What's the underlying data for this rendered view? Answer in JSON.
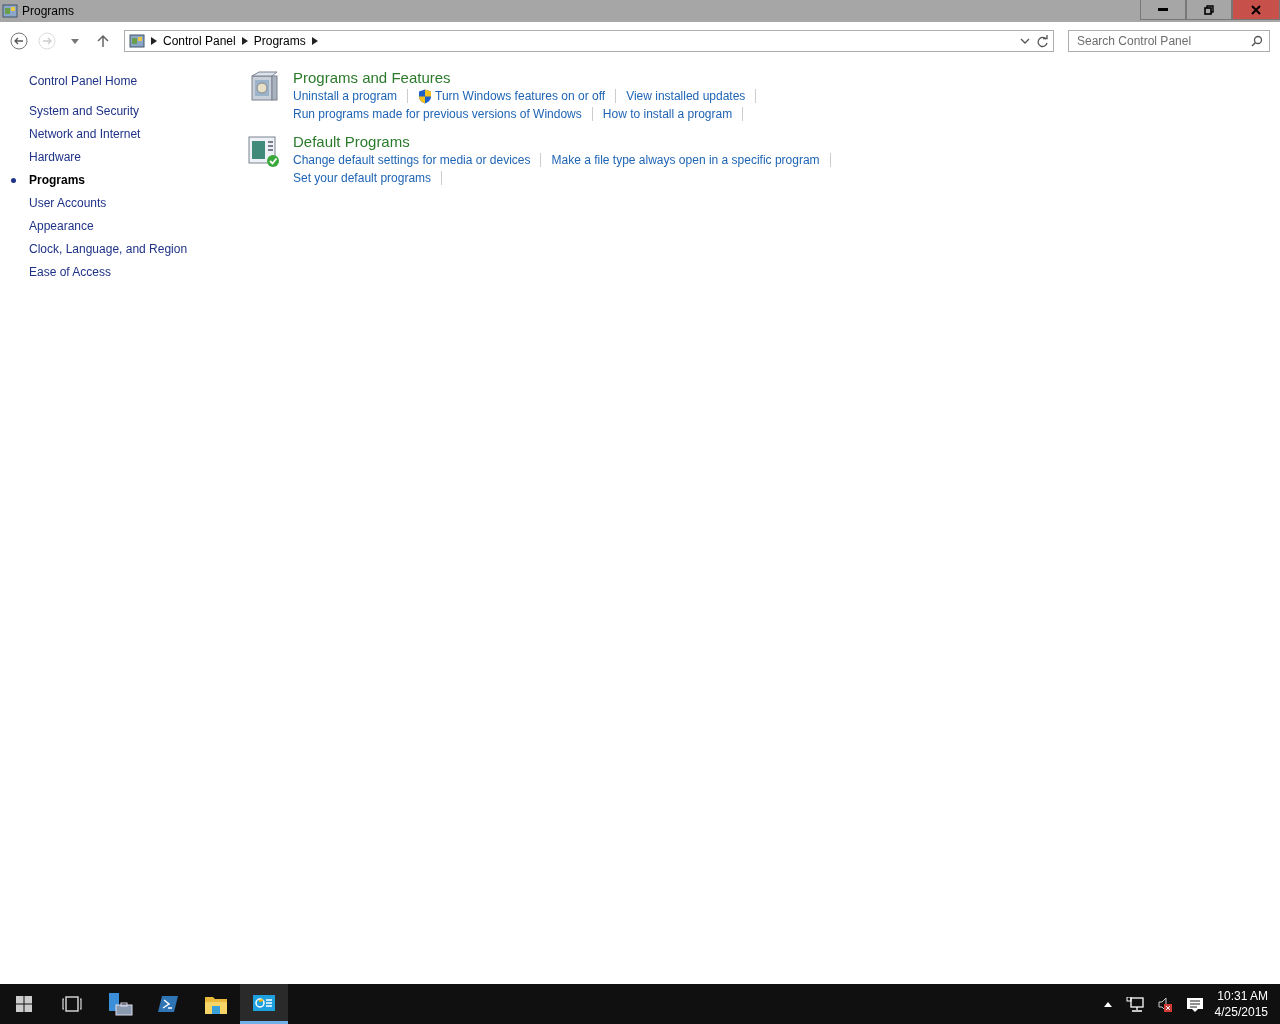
{
  "window": {
    "title": "Programs"
  },
  "address_bar": {
    "breadcrumbs": [
      "Control Panel",
      "Programs"
    ]
  },
  "search": {
    "placeholder": "Search Control Panel"
  },
  "sidebar": {
    "home": "Control Panel Home",
    "items": [
      {
        "label": "System and Security",
        "selected": false
      },
      {
        "label": "Network and Internet",
        "selected": false
      },
      {
        "label": "Hardware",
        "selected": false
      },
      {
        "label": "Programs",
        "selected": true
      },
      {
        "label": "User Accounts",
        "selected": false
      },
      {
        "label": "Appearance",
        "selected": false
      },
      {
        "label": "Clock, Language, and Region",
        "selected": false
      },
      {
        "label": "Ease of Access",
        "selected": false
      }
    ]
  },
  "categories": [
    {
      "kind": "programs",
      "title": "Programs and Features",
      "lines": [
        [
          {
            "text": "Uninstall a program",
            "shield": false
          },
          {
            "text": "Turn Windows features on or off",
            "shield": true
          },
          {
            "text": "View installed updates",
            "shield": false
          }
        ],
        [
          {
            "text": "Run programs made for previous versions of Windows",
            "shield": false
          },
          {
            "text": "How to install a program",
            "shield": false
          }
        ]
      ]
    },
    {
      "kind": "defaults",
      "title": "Default Programs",
      "lines": [
        [
          {
            "text": "Change default settings for media or devices",
            "shield": false
          },
          {
            "text": "Make a file type always open in a specific program",
            "shield": false
          }
        ],
        [
          {
            "text": "Set your default programs",
            "shield": false
          }
        ]
      ]
    }
  ],
  "taskbar": {
    "items": [
      {
        "kind": "start",
        "selected": false
      },
      {
        "kind": "taskview",
        "selected": false
      },
      {
        "kind": "server",
        "selected": false
      },
      {
        "kind": "shell",
        "selected": false
      },
      {
        "kind": "folder",
        "selected": false
      },
      {
        "kind": "panel",
        "selected": true
      }
    ],
    "time": "10:31 AM",
    "date": "4/25/2015"
  }
}
